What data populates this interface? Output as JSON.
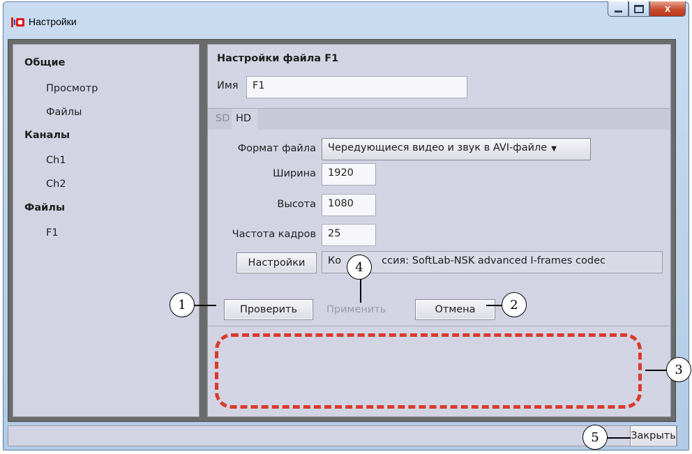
{
  "window": {
    "title": "Настройки",
    "close_glyph": "x"
  },
  "nav": {
    "items": [
      {
        "label": "Общие",
        "kind": "group"
      },
      {
        "label": "Просмотр",
        "kind": "child"
      },
      {
        "label": "Файлы",
        "kind": "child"
      },
      {
        "label": "Каналы",
        "kind": "group"
      },
      {
        "label": "Ch1",
        "kind": "child"
      },
      {
        "label": "Ch2",
        "kind": "child"
      },
      {
        "label": "Файлы",
        "kind": "group"
      },
      {
        "label": "F1",
        "kind": "child"
      }
    ]
  },
  "main": {
    "title": "Настройки файла F1",
    "name_label": "Имя",
    "name_value": "F1",
    "tabs": [
      {
        "label": "SD",
        "active": false
      },
      {
        "label": "HD",
        "active": true
      }
    ],
    "format_label": "Формат файла",
    "format_value": "Чередующиеся видео и звук в AVI-файле",
    "width_label": "Ширина",
    "width_value": "1920",
    "height_label": "Высота",
    "height_value": "1080",
    "fps_label": "Частота кадров",
    "fps_value": "25",
    "settings_button": "Настройки",
    "codec_prefix": "Ко",
    "codec_suffix": "ссия: SoftLab-NSK advanced I-frames codec",
    "check_button": "Проверить",
    "apply_button": "Применить",
    "cancel_button": "Отмена"
  },
  "footer": {
    "close_button": "Закрыть"
  },
  "callouts": [
    "1",
    "2",
    "3",
    "4",
    "5"
  ],
  "colors": {
    "panel": "#d3d4e3",
    "frame": "#6b6b6b",
    "highlight_dash": "#d93a2c"
  }
}
